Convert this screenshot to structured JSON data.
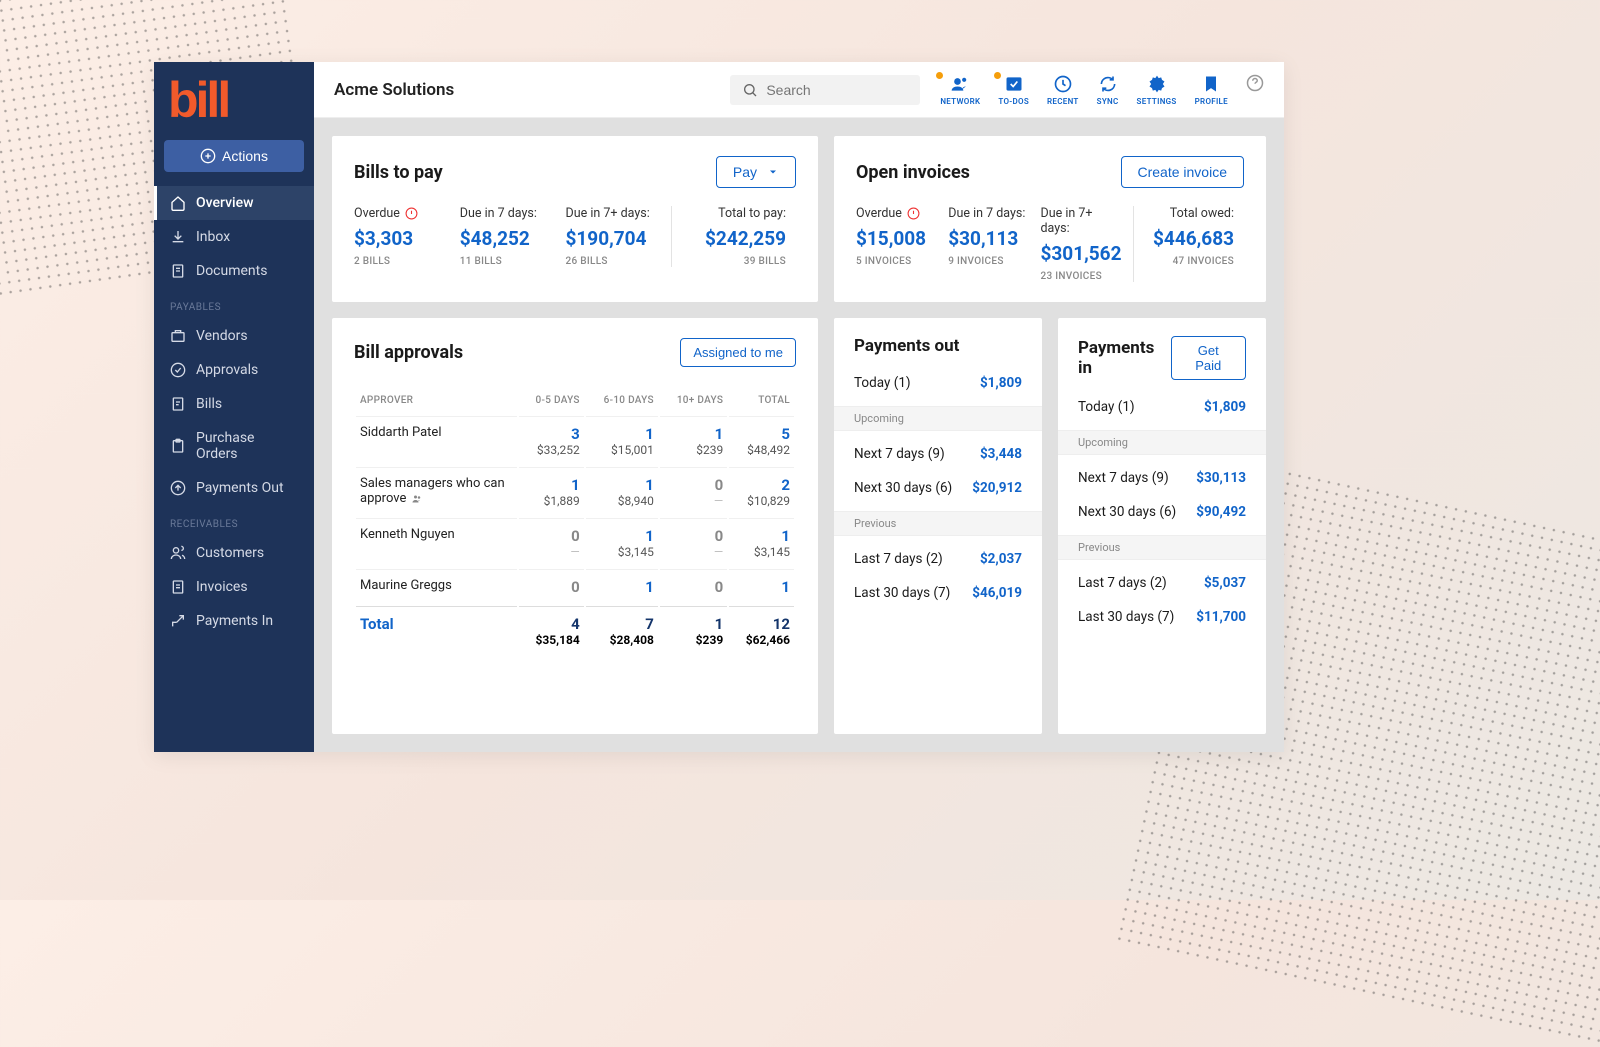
{
  "logo": "bill",
  "actions_label": "Actions",
  "company": "Acme Solutions",
  "search_placeholder": "Search",
  "topnav": {
    "network": "NETWORK",
    "todos": "TO-DOS",
    "recent": "RECENT",
    "sync": "SYNC",
    "settings": "SETTINGS",
    "profile": "PROFILE"
  },
  "sidebar": {
    "overview": "Overview",
    "inbox": "Inbox",
    "documents": "Documents",
    "section_payables": "PAYABLES",
    "vendors": "Vendors",
    "approvals": "Approvals",
    "bills": "Bills",
    "purchase_orders": "Purchase Orders",
    "payments_out": "Payments Out",
    "section_receivables": "RECEIVABLES",
    "customers": "Customers",
    "invoices": "Invoices",
    "payments_in": "Payments In"
  },
  "bills_card": {
    "title": "Bills to pay",
    "pay_btn": "Pay",
    "overdue": {
      "label": "Overdue",
      "value": "$3,303",
      "sub": "2 BILLS"
    },
    "due7": {
      "label": "Due in 7 days:",
      "value": "$48,252",
      "sub": "11 BILLS"
    },
    "due7p": {
      "label": "Due in 7+ days:",
      "value": "$190,704",
      "sub": "26 BILLS"
    },
    "total": {
      "label": "Total to pay:",
      "value": "$242,259",
      "sub": "39 BILLS"
    }
  },
  "invoices_card": {
    "title": "Open invoices",
    "create_btn": "Create invoice",
    "overdue": {
      "label": "Overdue",
      "value": "$15,008",
      "sub": "5 INVOICES"
    },
    "due7": {
      "label": "Due in 7 days:",
      "value": "$30,113",
      "sub": "9 INVOICES"
    },
    "due7p": {
      "label": "Due in 7+ days:",
      "value": "$301,562",
      "sub": "23 INVOICES"
    },
    "total": {
      "label": "Total owed:",
      "value": "$446,683",
      "sub": "47 INVOICES"
    }
  },
  "approvals_card": {
    "title": "Bill approvals",
    "assigned_btn": "Assigned to me",
    "headers": {
      "approver": "APPROVER",
      "c1": "0-5 DAYS",
      "c2": "6-10 DAYS",
      "c3": "10+ DAYS",
      "c4": "TOTAL"
    },
    "rows": [
      {
        "name": "Siddarth Patel",
        "c1": {
          "n": "3",
          "a": "$33,252"
        },
        "c2": {
          "n": "1",
          "a": "$15,001"
        },
        "c3": {
          "n": "1",
          "a": "$239"
        },
        "c4": {
          "n": "5",
          "a": "$48,492"
        }
      },
      {
        "name": "Sales managers  who can approve",
        "group": true,
        "c1": {
          "n": "1",
          "a": "$1,889"
        },
        "c2": {
          "n": "1",
          "a": "$8,940"
        },
        "c3": {
          "n": "0",
          "a": "—"
        },
        "c4": {
          "n": "2",
          "a": "$10,829"
        }
      },
      {
        "name": "Kenneth Nguyen",
        "c1": {
          "n": "0",
          "a": "—"
        },
        "c2": {
          "n": "1",
          "a": "$3,145"
        },
        "c3": {
          "n": "0",
          "a": "—"
        },
        "c4": {
          "n": "1",
          "a": "$3,145"
        }
      },
      {
        "name": "Maurine Greggs",
        "c1": {
          "n": "0",
          "a": ""
        },
        "c2": {
          "n": "1",
          "a": ""
        },
        "c3": {
          "n": "0",
          "a": ""
        },
        "c4": {
          "n": "1",
          "a": ""
        }
      }
    ],
    "total_row": {
      "label": "Total",
      "c1": {
        "n": "4",
        "a": "$35,184"
      },
      "c2": {
        "n": "7",
        "a": "$28,408"
      },
      "c3": {
        "n": "1",
        "a": "$239"
      },
      "c4": {
        "n": "12",
        "a": "$62,466"
      }
    }
  },
  "payments_out": {
    "title": "Payments out",
    "today": {
      "label": "Today (1)",
      "value": "$1,809"
    },
    "upcoming_label": "Upcoming",
    "next7": {
      "label": "Next 7 days (9)",
      "value": "$3,448"
    },
    "next30": {
      "label": "Next 30 days (6)",
      "value": "$20,912"
    },
    "previous_label": "Previous",
    "last7": {
      "label": "Last 7 days (2)",
      "value": "$2,037"
    },
    "last30": {
      "label": "Last  30 days (7)",
      "value": "$46,019"
    }
  },
  "payments_in": {
    "title": "Payments in",
    "getpaid_btn": "Get Paid",
    "today": {
      "label": "Today (1)",
      "value": "$1,809"
    },
    "upcoming_label": "Upcoming",
    "next7": {
      "label": "Next 7 days (9)",
      "value": "$30,113"
    },
    "next30": {
      "label": "Next 30 days (6)",
      "value": "$90,492"
    },
    "previous_label": "Previous",
    "last7": {
      "label": "Last 7 days (2)",
      "value": "$5,037"
    },
    "last30": {
      "label": "Last  30 days (7)",
      "value": "$11,700"
    }
  }
}
